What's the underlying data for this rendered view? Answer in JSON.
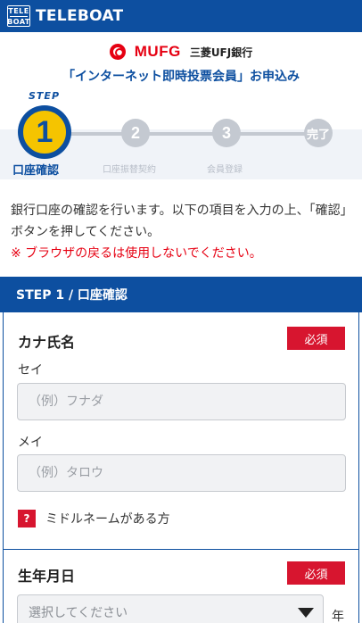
{
  "topbar": {
    "logo_top": "TELE",
    "logo_bottom": "BOAT",
    "brand": "TELEBOAT"
  },
  "bank": {
    "logo_text": "MUFG",
    "name": "三菱UFJ銀行"
  },
  "apply_title": "「インターネット即時投票会員」お申込み",
  "steps": {
    "word": "STEP",
    "items": [
      {
        "number": "1",
        "label": "口座確認",
        "active": true
      },
      {
        "number": "2",
        "label": "口座振替契約",
        "active": false
      },
      {
        "number": "3",
        "label": "会員登録",
        "active": false
      },
      {
        "number": "完了",
        "label": "",
        "active": false
      }
    ]
  },
  "intro": {
    "text": "銀行口座の確認を行います。以下の項目を入力の上、「確認」ボタンを押してください。",
    "warning": "※ ブラウザの戻るは使用しないでください。"
  },
  "panel": {
    "title": "STEP 1 / 口座確認",
    "kana_name": {
      "title": "カナ氏名",
      "required": "必須",
      "sei_label": "セイ",
      "sei_placeholder": "（例）フナダ",
      "mei_label": "メイ",
      "mei_placeholder": "（例）タロウ",
      "middle_name_icon": "?",
      "middle_name_label": "ミドルネームがある方"
    },
    "birthdate": {
      "title": "生年月日",
      "required": "必須",
      "year_select_placeholder": "選択してください",
      "year_unit": "年"
    }
  },
  "colors": {
    "primary": "#0d4fa0",
    "accent": "#e60012",
    "required": "#d7152f",
    "step_active": "#f5c400"
  },
  "icons": {
    "dropdown": "chevron-down-icon",
    "bank": "mufg-logo-icon",
    "help": "question-icon"
  }
}
